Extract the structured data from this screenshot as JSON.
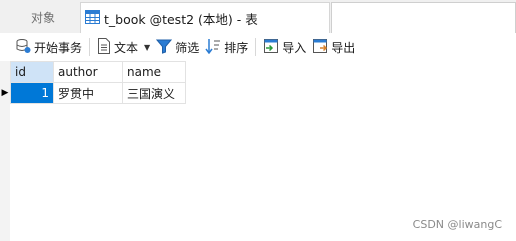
{
  "tabs": {
    "objects_label": "对象",
    "active_label": "t_book @test2 (本地) - 表"
  },
  "toolbar": {
    "begin_transaction": "开始事务",
    "text": "文本",
    "filter": "筛选",
    "sort": "排序",
    "import": "导入",
    "export": "导出"
  },
  "grid": {
    "columns": [
      "id",
      "author",
      "name"
    ],
    "rows": [
      {
        "id": "1",
        "author": "罗贯中",
        "name": "三国演义"
      }
    ]
  },
  "watermark": "CSDN @liwangC",
  "colors": {
    "selected_cell": "#0078d7",
    "header_active": "#cfe3f7",
    "icon_blue": "#2b7cd3"
  },
  "icons": [
    "table-icon",
    "transaction-icon",
    "text-icon",
    "filter-icon",
    "sort-icon",
    "import-icon",
    "export-icon",
    "row-pointer-icon"
  ]
}
